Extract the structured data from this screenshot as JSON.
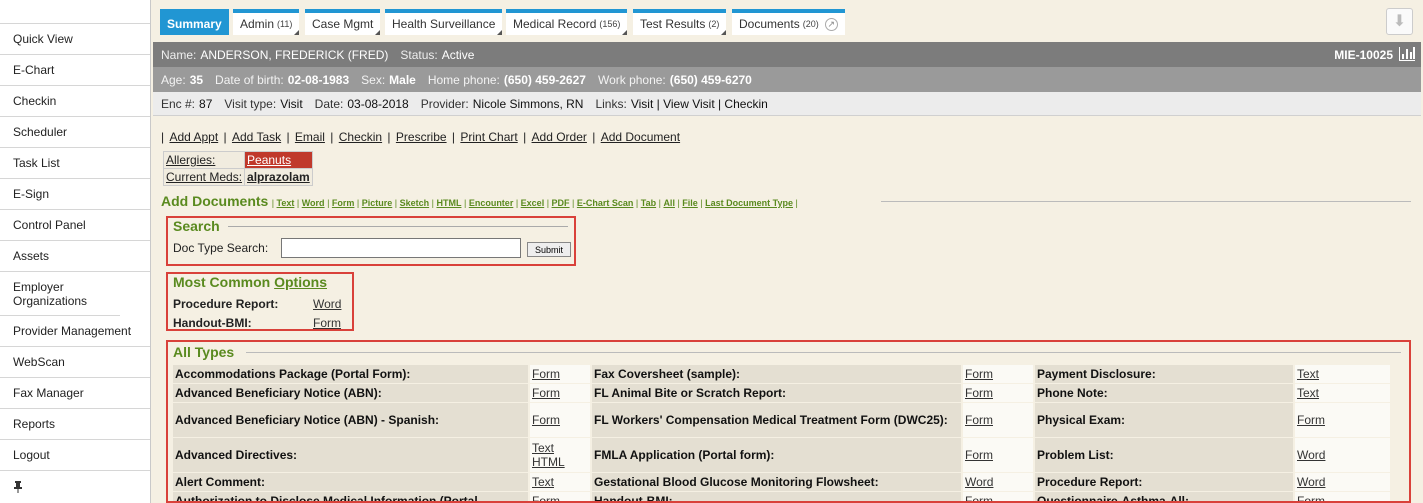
{
  "sidebar": {
    "items": [
      "Quick View",
      "E-Chart",
      "Checkin",
      "Scheduler",
      "Task List",
      "E-Sign",
      "Control Panel",
      "Assets",
      "Employer Organizations",
      "Provider Management",
      "WebScan",
      "Fax Manager",
      "Reports",
      "Logout"
    ]
  },
  "tabs": [
    {
      "label": "Summary",
      "count": ""
    },
    {
      "label": "Admin",
      "count": "(11)"
    },
    {
      "label": "Case Mgmt",
      "count": ""
    },
    {
      "label": "Health Surveillance",
      "count": ""
    },
    {
      "label": "Medical Record",
      "count": "(156)"
    },
    {
      "label": "Test Results",
      "count": "(2)"
    },
    {
      "label": "Documents",
      "count": "(20)"
    }
  ],
  "patient": {
    "name_label": "Name:",
    "name": "ANDERSON, FREDERICK (FRED)",
    "status_label": "Status:",
    "status": "Active",
    "mrn": "MIE-10025",
    "age_label": "Age:",
    "age": "35",
    "dob_label": "Date of birth:",
    "dob": "02-08-1983",
    "sex_label": "Sex:",
    "sex": "Male",
    "home_label": "Home phone:",
    "home": "(650) 459-2627",
    "work_label": "Work phone:",
    "work": "(650) 459-6270"
  },
  "encounter": {
    "enc_label": "Enc #:",
    "enc": "87",
    "type_label": "Visit type:",
    "type": "Visit",
    "date_label": "Date:",
    "date": "03-08-2018",
    "provider_label": "Provider:",
    "provider": "Nicole Simmons, RN",
    "links_label": "Links:",
    "links": "Visit | View Visit | Checkin"
  },
  "actions": [
    "Add Appt",
    "Add Task",
    "Email",
    "Checkin",
    "Prescribe",
    "Print Chart",
    "Add Order",
    "Add Document"
  ],
  "med_summary": {
    "allergies_label": "Allergies:",
    "allergies": "Peanuts",
    "meds_label": "Current Meds:",
    "meds": "alprazolam"
  },
  "add_documents": {
    "title": "Add Documents",
    "type_links": [
      "Text",
      "Word",
      "Form",
      "Picture",
      "Sketch",
      "HTML",
      "Encounter",
      "Excel",
      "PDF",
      "E-Chart Scan",
      "Tab",
      "All",
      "File",
      "Last Document Type"
    ]
  },
  "search": {
    "title": "Search",
    "label": "Doc Type Search:",
    "value": "",
    "submit": "Submit"
  },
  "most_common": {
    "title": "Most Common",
    "options_link": "Options",
    "rows": [
      {
        "name": "Procedure Report:",
        "link": "Word"
      },
      {
        "name": "Handout-BMI:",
        "link": "Form"
      }
    ]
  },
  "all_types": {
    "title": "All Types",
    "rows": [
      [
        {
          "n": "Accommodations Package (Portal Form):",
          "l": [
            "Form"
          ]
        },
        {
          "n": "Fax Coversheet (sample):",
          "l": [
            "Form"
          ]
        },
        {
          "n": "Payment Disclosure:",
          "l": [
            "Text"
          ]
        }
      ],
      [
        {
          "n": "Advanced Beneficiary Notice (ABN):",
          "l": [
            "Form"
          ]
        },
        {
          "n": "FL Animal Bite or Scratch Report:",
          "l": [
            "Form"
          ]
        },
        {
          "n": "Phone Note:",
          "l": [
            "Text"
          ]
        }
      ],
      [
        {
          "n": "Advanced Beneficiary Notice (ABN) - Spanish:",
          "l": [
            "Form"
          ]
        },
        {
          "n": "FL Workers' Compensation Medical Treatment Form (DWC25):",
          "l": [
            "Form"
          ]
        },
        {
          "n": "Physical Exam:",
          "l": [
            "Form"
          ]
        }
      ],
      [
        {
          "n": "Advanced Directives:",
          "l": [
            "Text",
            "HTML"
          ]
        },
        {
          "n": "FMLA Application (Portal form):",
          "l": [
            "Form"
          ]
        },
        {
          "n": "Problem List:",
          "l": [
            "Word"
          ]
        }
      ],
      [
        {
          "n": "Alert Comment:",
          "l": [
            "Text"
          ]
        },
        {
          "n": "Gestational Blood Glucose Monitoring Flowsheet:",
          "l": [
            "Word"
          ]
        },
        {
          "n": "Procedure Report:",
          "l": [
            "Word"
          ]
        }
      ],
      [
        {
          "n": "Authorization to Disclose Medical Information (Portal",
          "l": [
            "Form"
          ]
        },
        {
          "n": "Handout-BMI:",
          "l": [
            "Form"
          ]
        },
        {
          "n": "Questionnaire-Asthma-All:",
          "l": [
            "Form"
          ]
        }
      ]
    ]
  }
}
